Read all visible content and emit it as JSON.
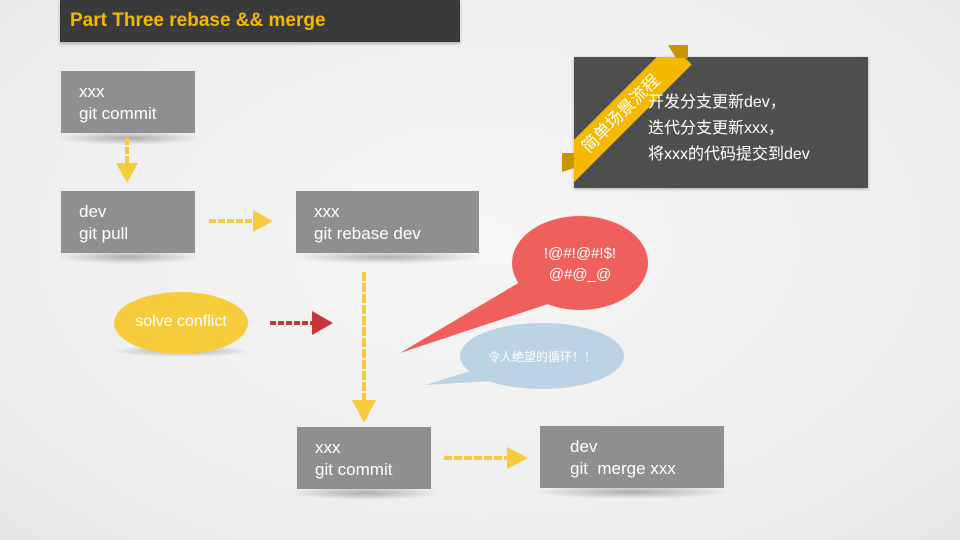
{
  "title": "Part Three rebase && merge",
  "boxes": {
    "xxx_commit_1": [
      "xxx",
      "git commit"
    ],
    "dev_pull": [
      "dev",
      "git pull"
    ],
    "xxx_rebase": [
      "xxx",
      "git rebase dev"
    ],
    "xxx_commit_2": [
      "xxx",
      "git commit"
    ],
    "dev_merge": [
      "dev",
      "git  merge xxx"
    ]
  },
  "solve_conflict": "solve conflict",
  "ribbon": "简单场景流程",
  "scenario_lines": [
    "开发分支更新dev，",
    "迭代分支更新xxx，",
    "将xxx的代码提交到dev"
  ],
  "bubble_red": [
    "!@#!@#!$!",
    "@#@_@"
  ],
  "bubble_blue": "令人绝望的循环！！",
  "colors": {
    "title_bg": "#3a3a3a",
    "accent_yellow": "#f5b800",
    "box_gray": "#8f8f8f",
    "info_bg": "#4f4f4f",
    "arrow_yellow": "#f7cc3c",
    "arrow_red": "#c8363c",
    "bubble_red": "#ef5f5b",
    "bubble_blue": "#bcd3e3"
  }
}
